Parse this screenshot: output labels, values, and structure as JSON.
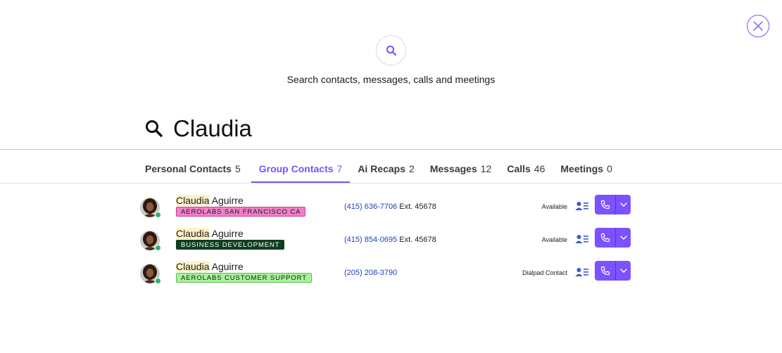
{
  "colors": {
    "accent": "#7c52ff",
    "presence_online": "#2bb36b",
    "phone_link": "#1f3fbf",
    "highlight": "#fff2c8"
  },
  "hero": {
    "icon": "search-icon",
    "text": "Search contacts, messages, calls and meetings"
  },
  "search": {
    "icon": "search-icon",
    "value": "Claudia"
  },
  "tabs": [
    {
      "label": "Personal Contacts",
      "count": "5",
      "active": false
    },
    {
      "label": "Group Contacts",
      "count": "7",
      "active": true
    },
    {
      "label": "Ai Recaps",
      "count": "2",
      "active": false
    },
    {
      "label": "Messages",
      "count": "12",
      "active": false
    },
    {
      "label": "Calls",
      "count": "46",
      "active": false
    },
    {
      "label": "Meetings",
      "count": "0",
      "active": false
    }
  ],
  "results": [
    {
      "name_match": "Claudia",
      "name_rest": " Aguirre",
      "tag": "AEROLABS SAN FRANCISCO CA",
      "tag_bg": "#f27fc8",
      "tag_border": "#c0409a",
      "tag_color": "#1b1b1b",
      "phone": "(415) 636-7706",
      "ext": " Ext. 45678",
      "status": "Available"
    },
    {
      "name_match": "Claudia",
      "name_rest": " Aguirre",
      "tag": "BUSINESS DEVELOPMENT",
      "tag_bg": "#0f3d20",
      "tag_border": "#0f3d20",
      "tag_color": "#ffffff",
      "phone": "(415) 854-0695",
      "ext": " Ext. 45678",
      "status": "Available"
    },
    {
      "name_match": "Claudia",
      "name_rest": " Aguirre",
      "tag": "AEROLABS CUSTOMER SUPPORT",
      "tag_bg": "#a6f29a",
      "tag_border": "#5fbf56",
      "tag_color": "#1b1b1b",
      "phone": "(205) 208-3790",
      "ext": "",
      "status": "Dialpad Contact"
    }
  ]
}
